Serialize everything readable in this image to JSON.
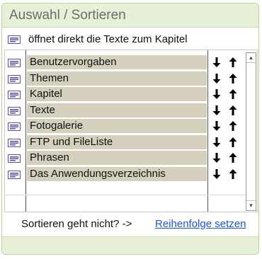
{
  "panel": {
    "title": "Auswahl / Sortieren",
    "hint": "öffnet direkt die Texte zum Kapitel"
  },
  "icons": {
    "row_icon": "text-document-icon",
    "move_down": "arrow-down-icon",
    "move_up": "arrow-up-icon"
  },
  "list": {
    "items": [
      {
        "label": "Benutzervorgaben"
      },
      {
        "label": "Themen"
      },
      {
        "label": "Kapitel"
      },
      {
        "label": "Texte"
      },
      {
        "label": "Fotogalerie"
      },
      {
        "label": "FTP und FileListe"
      },
      {
        "label": "Phrasen"
      },
      {
        "label": "Das Anwendungsverzeichnis"
      }
    ]
  },
  "footer": {
    "sort_question": "Sortieren geht nicht? ->",
    "sort_link": "Reihenfolge setzen"
  },
  "colors": {
    "header_bg": "#e6f1d8",
    "panel_border": "#b7d19a",
    "item_bg": "#d4d0bd",
    "link": "#1a55d6",
    "icon_purple": "#5b4f9e"
  }
}
